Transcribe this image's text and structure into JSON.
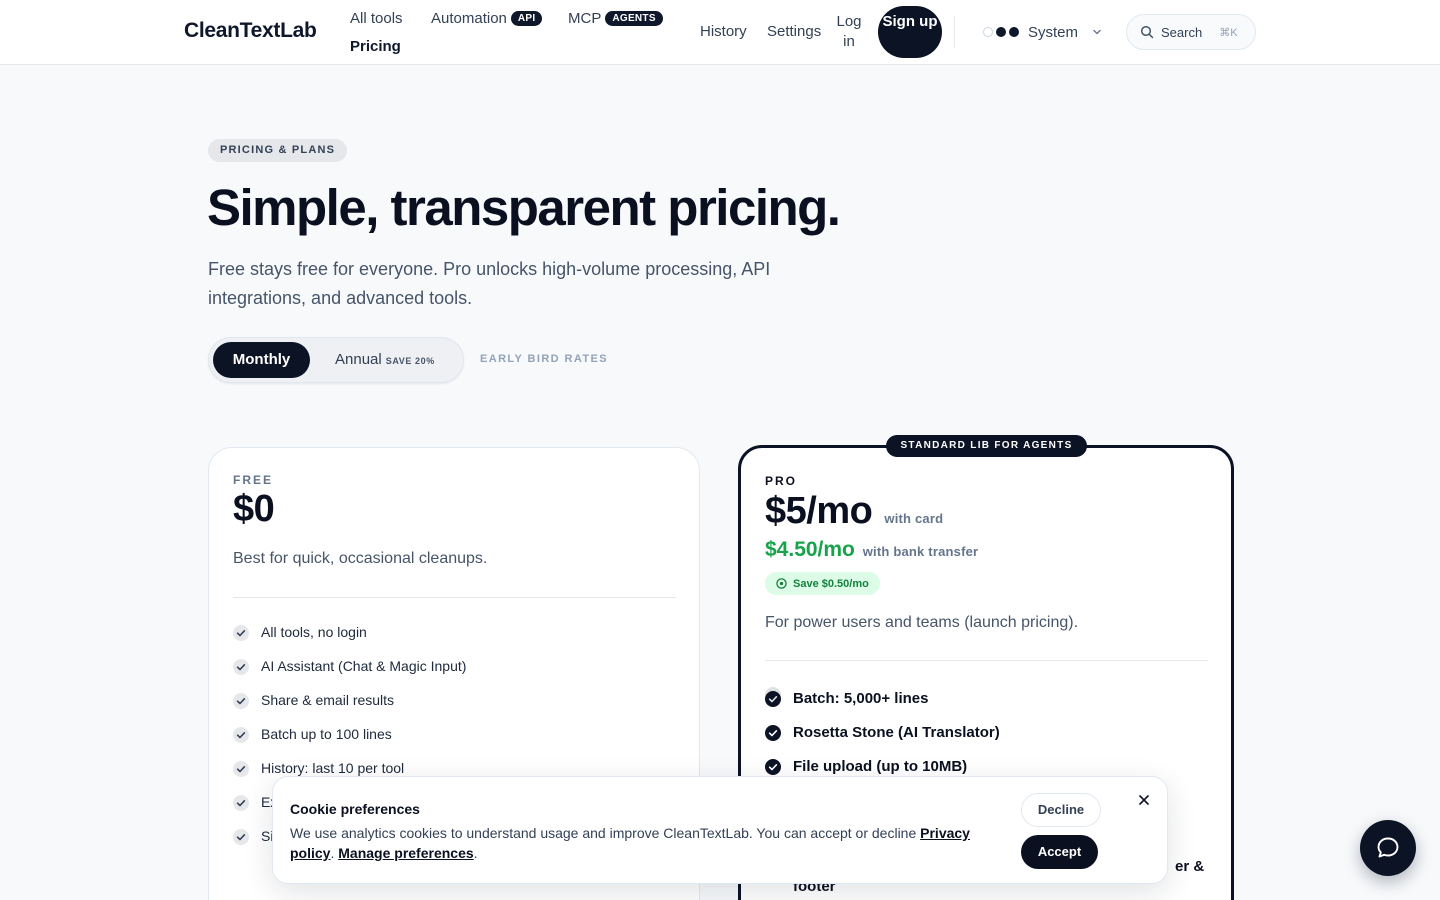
{
  "header": {
    "logo": "CleanTextLab",
    "nav": {
      "all_tools": "All tools",
      "automation": "Automation",
      "automation_badge": "API",
      "mcp": "MCP",
      "mcp_badge": "AGENTS",
      "pricing": "Pricing",
      "history": "History",
      "settings": "Settings",
      "login": "Log in",
      "signup": "Sign up"
    },
    "theme": {
      "label": "System"
    },
    "search": {
      "label": "Search",
      "shortcut": "⌘K"
    }
  },
  "hero": {
    "eyebrow": "PRICING & PLANS",
    "title": "Simple, transparent pricing.",
    "subtitle": "Free stays free for everyone. Pro unlocks high-volume processing, API integrations, and advanced tools.",
    "billing_toggle": {
      "monthly": "Monthly",
      "annual": "Annual",
      "annual_tag": "SAVE 20%",
      "selected": "Monthly"
    },
    "note": "EARLY BIRD RATES"
  },
  "plans": {
    "free": {
      "label": "FREE",
      "price": "$0",
      "description": "Best for quick, occasional cleanups.",
      "features": [
        "All tools, no login",
        "AI Assistant (Chat & Magic Input)",
        "Share & email results",
        "Batch up to 100 lines",
        "History: last 10 per tool",
        "Ex",
        "Si"
      ]
    },
    "pro": {
      "ribbon": "STANDARD LIB FOR AGENTS",
      "label": "PRO",
      "price": "$5/mo",
      "price_note": "with card",
      "alt_price": "$4.50/mo",
      "alt_price_note": "with bank transfer",
      "save_badge": "Save $0.50/mo",
      "description": "For power users and teams (launch pricing).",
      "features": [
        "Batch: 5,000+ lines",
        "Rosetta Stone (AI Translator)",
        "File upload (up to 10MB)"
      ],
      "partial_feature_tail": "er &",
      "partial_feature_line2": "footer"
    }
  },
  "cookie_banner": {
    "title": "Cookie preferences",
    "text": "We use analytics cookies to understand usage and improve CleanTextLab. You can accept or decline ",
    "privacy_link": "Privacy policy",
    "separator": ". ",
    "manage_link": "Manage preferences",
    "end": ".",
    "decline": "Decline",
    "accept": "Accept"
  },
  "icons": {
    "search": "search-icon",
    "chevron": "chevron-down-icon",
    "check": "check-circle-icon",
    "close": "close-icon",
    "chat": "chat-bubble-icon",
    "save": "coin-icon"
  },
  "colors": {
    "primary": "#0b1324",
    "green": "#16a34a",
    "background": "#f7f9fb"
  }
}
